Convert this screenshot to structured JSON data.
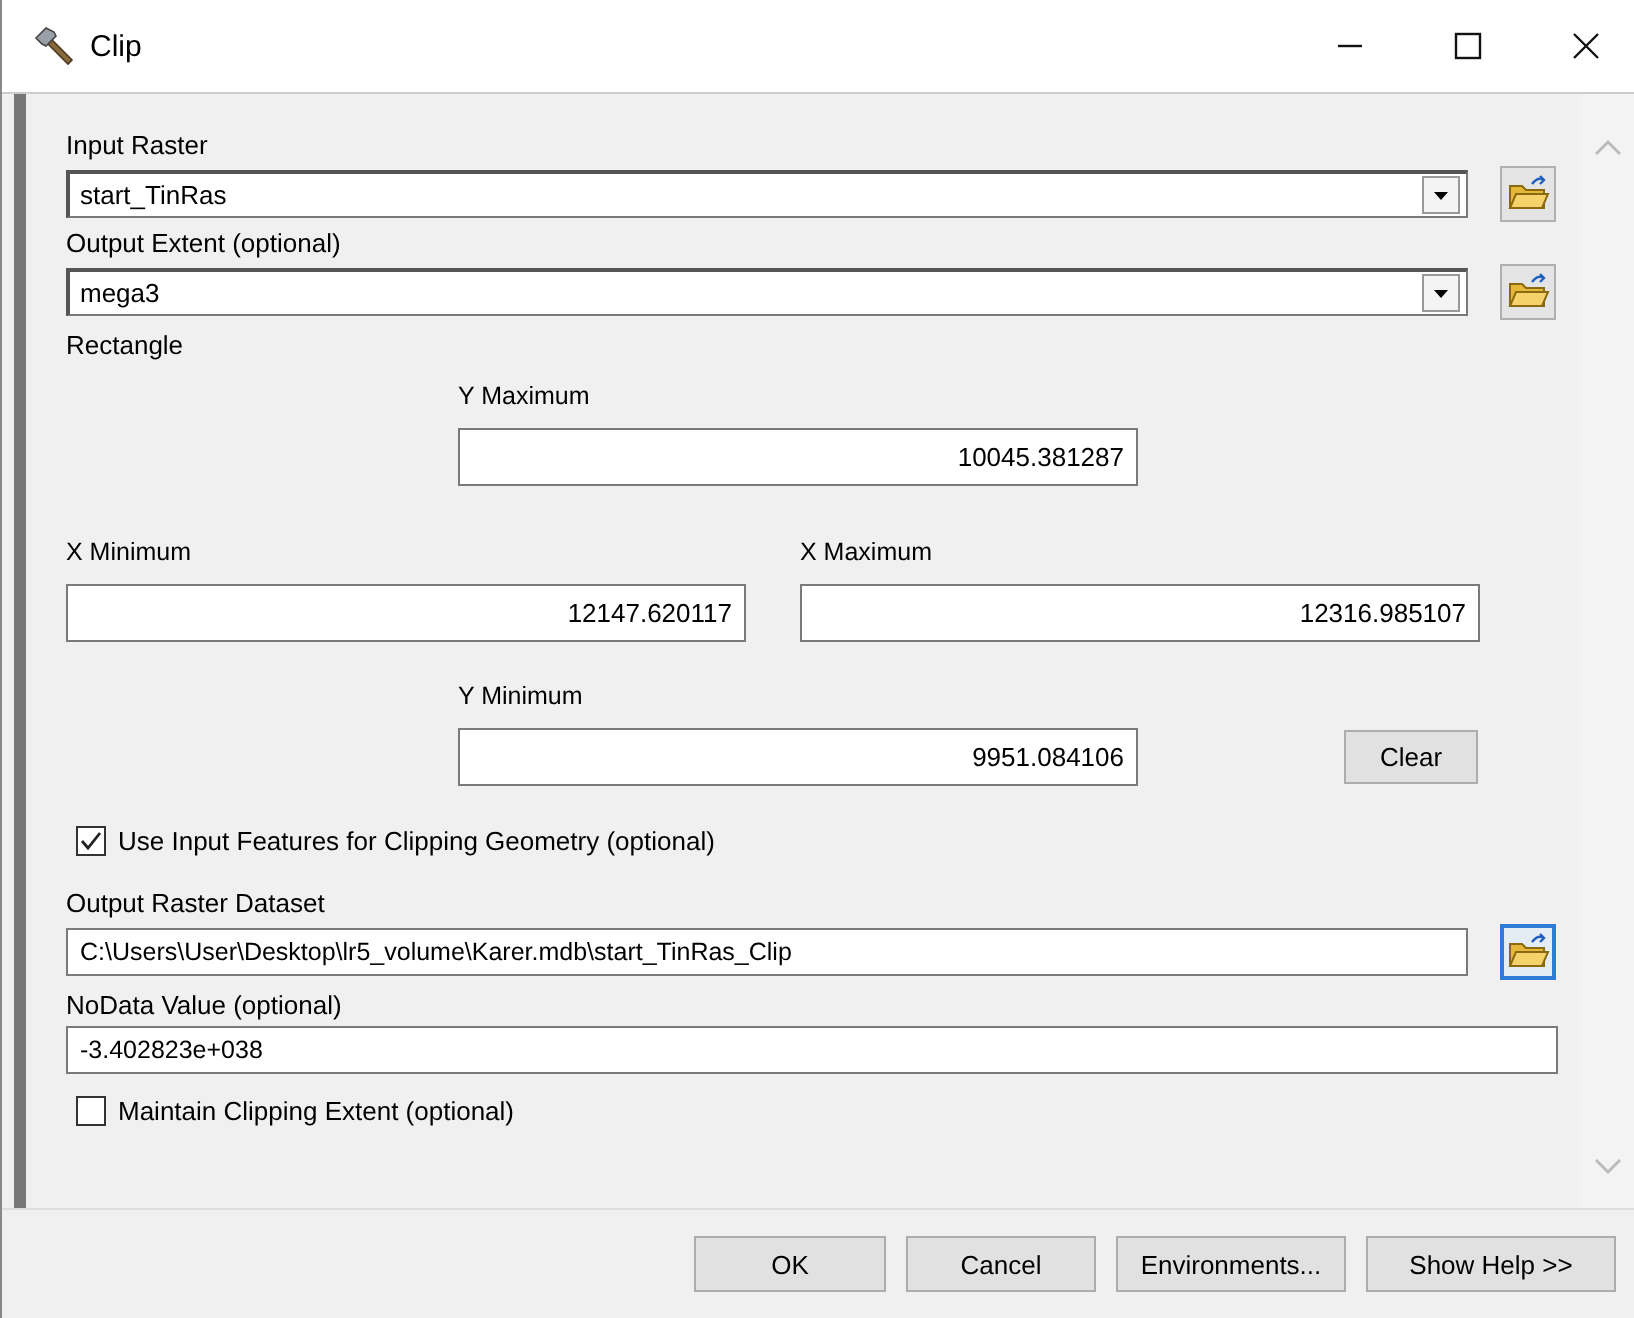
{
  "window": {
    "title": "Clip"
  },
  "input_raster": {
    "label": "Input Raster",
    "value": "start_TinRas"
  },
  "output_extent": {
    "label": "Output Extent (optional)",
    "value": "mega3"
  },
  "rectangle": {
    "label": "Rectangle",
    "y_max": {
      "label": "Y Maximum",
      "value": "10045.381287"
    },
    "x_min": {
      "label": "X Minimum",
      "value": "12147.620117"
    },
    "x_max": {
      "label": "X Maximum",
      "value": "12316.985107"
    },
    "y_min": {
      "label": "Y Minimum",
      "value": "9951.084106"
    },
    "clear_button": "Clear"
  },
  "use_input_features": {
    "label": "Use Input Features for Clipping Geometry (optional)",
    "checked": true
  },
  "output_raster_dataset": {
    "label": "Output Raster Dataset",
    "value": "C:\\Users\\User\\Desktop\\lr5_volume\\Karer.mdb\\start_TinRas_Clip"
  },
  "nodata": {
    "label": "NoData Value (optional)",
    "value": "-3.402823e+038"
  },
  "maintain_clipping_extent": {
    "label": "Maintain Clipping Extent (optional)",
    "checked": false
  },
  "buttons": [
    "OK",
    "Cancel",
    "Environments...",
    "Show Help >>"
  ]
}
